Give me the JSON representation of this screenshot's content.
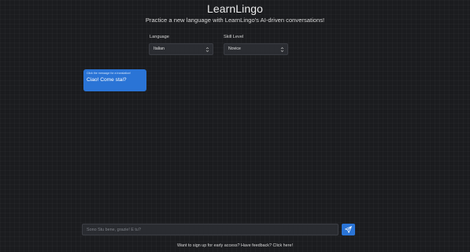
{
  "header": {
    "title": "LearnLingo",
    "subtitle": "Practice a new language with LearnLingo's AI-driven conversations!"
  },
  "controls": {
    "language": {
      "label": "Language",
      "selected": "Italian"
    },
    "skill_level": {
      "label": "Skill Level",
      "selected": "Novice"
    }
  },
  "chat": {
    "messages": [
      {
        "hint": "Click the message for a translation!",
        "text": "Ciao! Come stai?"
      }
    ]
  },
  "composer": {
    "placeholder": "Sono Stu bene, grazie! E tu?",
    "send_icon": "paper-plane-icon"
  },
  "footer": {
    "link_text": "Want to sign up for early access? Have feedback? Click here!"
  },
  "colors": {
    "background": "#1b1c1f",
    "accent": "#2a74d6",
    "control_bg": "#2b2d32"
  }
}
